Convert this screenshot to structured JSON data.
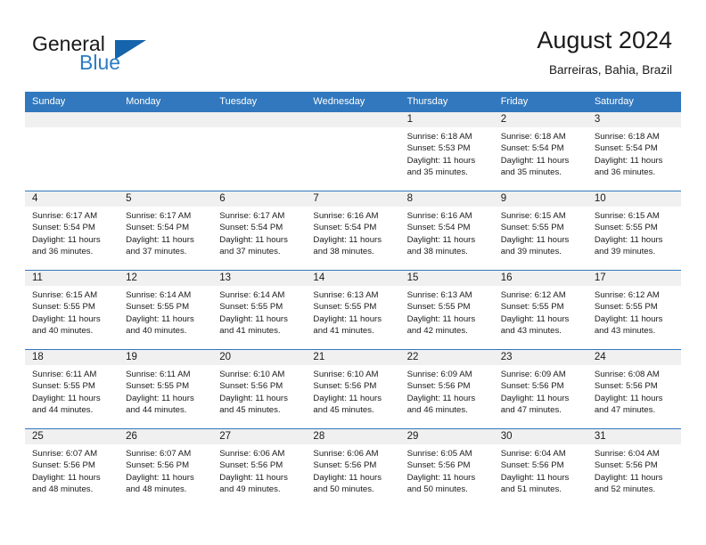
{
  "brand": {
    "name_part1": "General",
    "name_part2": "Blue",
    "triangle_icon": "triangle-icon",
    "accent_color": "#1664ab",
    "blue_text_color": "#2b7cc4"
  },
  "header": {
    "title": "August 2024",
    "location": "Barreiras, Bahia, Brazil"
  },
  "calendar": {
    "header_bg": "#3178be",
    "daynum_band_bg": "#f0f0f0",
    "weekday_headers": [
      "Sunday",
      "Monday",
      "Tuesday",
      "Wednesday",
      "Thursday",
      "Friday",
      "Saturday"
    ],
    "weeks": [
      [
        {
          "day": "",
          "lines": []
        },
        {
          "day": "",
          "lines": []
        },
        {
          "day": "",
          "lines": []
        },
        {
          "day": "",
          "lines": []
        },
        {
          "day": "1",
          "lines": [
            "Sunrise: 6:18 AM",
            "Sunset: 5:53 PM",
            "Daylight: 11 hours",
            "and 35 minutes."
          ]
        },
        {
          "day": "2",
          "lines": [
            "Sunrise: 6:18 AM",
            "Sunset: 5:54 PM",
            "Daylight: 11 hours",
            "and 35 minutes."
          ]
        },
        {
          "day": "3",
          "lines": [
            "Sunrise: 6:18 AM",
            "Sunset: 5:54 PM",
            "Daylight: 11 hours",
            "and 36 minutes."
          ]
        }
      ],
      [
        {
          "day": "4",
          "lines": [
            "Sunrise: 6:17 AM",
            "Sunset: 5:54 PM",
            "Daylight: 11 hours",
            "and 36 minutes."
          ]
        },
        {
          "day": "5",
          "lines": [
            "Sunrise: 6:17 AM",
            "Sunset: 5:54 PM",
            "Daylight: 11 hours",
            "and 37 minutes."
          ]
        },
        {
          "day": "6",
          "lines": [
            "Sunrise: 6:17 AM",
            "Sunset: 5:54 PM",
            "Daylight: 11 hours",
            "and 37 minutes."
          ]
        },
        {
          "day": "7",
          "lines": [
            "Sunrise: 6:16 AM",
            "Sunset: 5:54 PM",
            "Daylight: 11 hours",
            "and 38 minutes."
          ]
        },
        {
          "day": "8",
          "lines": [
            "Sunrise: 6:16 AM",
            "Sunset: 5:54 PM",
            "Daylight: 11 hours",
            "and 38 minutes."
          ]
        },
        {
          "day": "9",
          "lines": [
            "Sunrise: 6:15 AM",
            "Sunset: 5:55 PM",
            "Daylight: 11 hours",
            "and 39 minutes."
          ]
        },
        {
          "day": "10",
          "lines": [
            "Sunrise: 6:15 AM",
            "Sunset: 5:55 PM",
            "Daylight: 11 hours",
            "and 39 minutes."
          ]
        }
      ],
      [
        {
          "day": "11",
          "lines": [
            "Sunrise: 6:15 AM",
            "Sunset: 5:55 PM",
            "Daylight: 11 hours",
            "and 40 minutes."
          ]
        },
        {
          "day": "12",
          "lines": [
            "Sunrise: 6:14 AM",
            "Sunset: 5:55 PM",
            "Daylight: 11 hours",
            "and 40 minutes."
          ]
        },
        {
          "day": "13",
          "lines": [
            "Sunrise: 6:14 AM",
            "Sunset: 5:55 PM",
            "Daylight: 11 hours",
            "and 41 minutes."
          ]
        },
        {
          "day": "14",
          "lines": [
            "Sunrise: 6:13 AM",
            "Sunset: 5:55 PM",
            "Daylight: 11 hours",
            "and 41 minutes."
          ]
        },
        {
          "day": "15",
          "lines": [
            "Sunrise: 6:13 AM",
            "Sunset: 5:55 PM",
            "Daylight: 11 hours",
            "and 42 minutes."
          ]
        },
        {
          "day": "16",
          "lines": [
            "Sunrise: 6:12 AM",
            "Sunset: 5:55 PM",
            "Daylight: 11 hours",
            "and 43 minutes."
          ]
        },
        {
          "day": "17",
          "lines": [
            "Sunrise: 6:12 AM",
            "Sunset: 5:55 PM",
            "Daylight: 11 hours",
            "and 43 minutes."
          ]
        }
      ],
      [
        {
          "day": "18",
          "lines": [
            "Sunrise: 6:11 AM",
            "Sunset: 5:55 PM",
            "Daylight: 11 hours",
            "and 44 minutes."
          ]
        },
        {
          "day": "19",
          "lines": [
            "Sunrise: 6:11 AM",
            "Sunset: 5:55 PM",
            "Daylight: 11 hours",
            "and 44 minutes."
          ]
        },
        {
          "day": "20",
          "lines": [
            "Sunrise: 6:10 AM",
            "Sunset: 5:56 PM",
            "Daylight: 11 hours",
            "and 45 minutes."
          ]
        },
        {
          "day": "21",
          "lines": [
            "Sunrise: 6:10 AM",
            "Sunset: 5:56 PM",
            "Daylight: 11 hours",
            "and 45 minutes."
          ]
        },
        {
          "day": "22",
          "lines": [
            "Sunrise: 6:09 AM",
            "Sunset: 5:56 PM",
            "Daylight: 11 hours",
            "and 46 minutes."
          ]
        },
        {
          "day": "23",
          "lines": [
            "Sunrise: 6:09 AM",
            "Sunset: 5:56 PM",
            "Daylight: 11 hours",
            "and 47 minutes."
          ]
        },
        {
          "day": "24",
          "lines": [
            "Sunrise: 6:08 AM",
            "Sunset: 5:56 PM",
            "Daylight: 11 hours",
            "and 47 minutes."
          ]
        }
      ],
      [
        {
          "day": "25",
          "lines": [
            "Sunrise: 6:07 AM",
            "Sunset: 5:56 PM",
            "Daylight: 11 hours",
            "and 48 minutes."
          ]
        },
        {
          "day": "26",
          "lines": [
            "Sunrise: 6:07 AM",
            "Sunset: 5:56 PM",
            "Daylight: 11 hours",
            "and 48 minutes."
          ]
        },
        {
          "day": "27",
          "lines": [
            "Sunrise: 6:06 AM",
            "Sunset: 5:56 PM",
            "Daylight: 11 hours",
            "and 49 minutes."
          ]
        },
        {
          "day": "28",
          "lines": [
            "Sunrise: 6:06 AM",
            "Sunset: 5:56 PM",
            "Daylight: 11 hours",
            "and 50 minutes."
          ]
        },
        {
          "day": "29",
          "lines": [
            "Sunrise: 6:05 AM",
            "Sunset: 5:56 PM",
            "Daylight: 11 hours",
            "and 50 minutes."
          ]
        },
        {
          "day": "30",
          "lines": [
            "Sunrise: 6:04 AM",
            "Sunset: 5:56 PM",
            "Daylight: 11 hours",
            "and 51 minutes."
          ]
        },
        {
          "day": "31",
          "lines": [
            "Sunrise: 6:04 AM",
            "Sunset: 5:56 PM",
            "Daylight: 11 hours",
            "and 52 minutes."
          ]
        }
      ]
    ]
  }
}
